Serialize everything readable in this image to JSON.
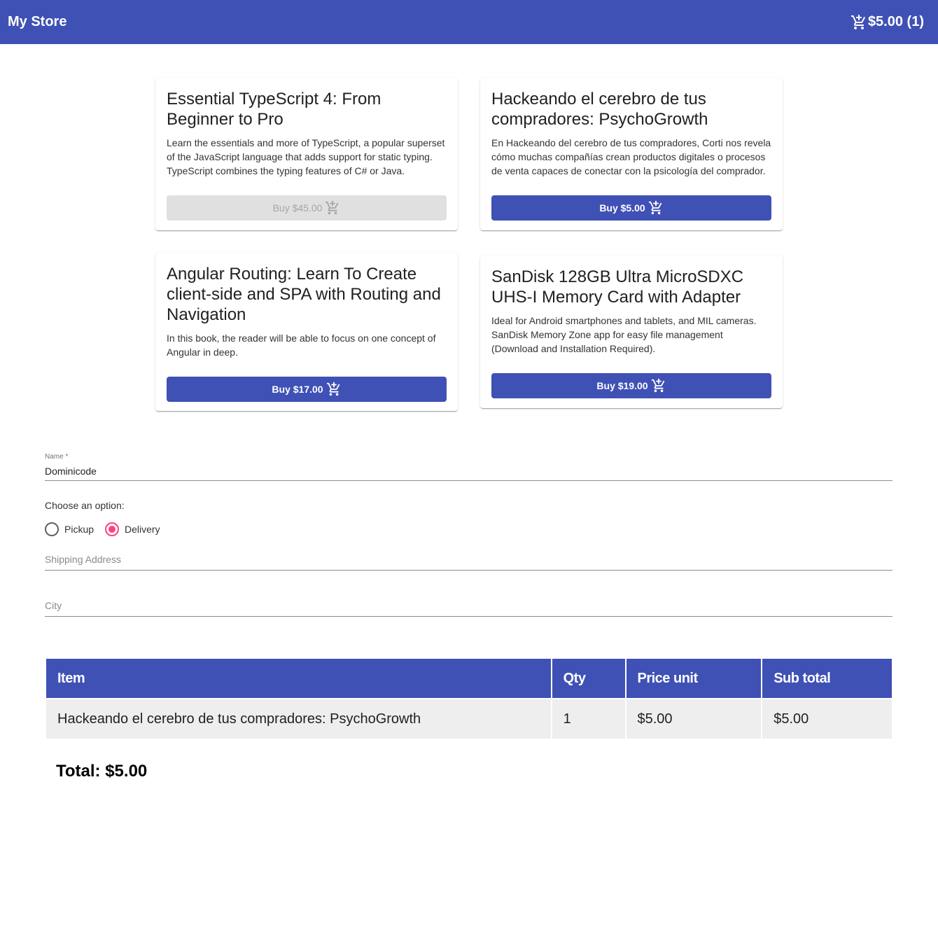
{
  "app": {
    "title": "My Store",
    "cart_total": "$5.00 (1)",
    "colors": {
      "primary": "#3f51b5",
      "accent": "#ff4081",
      "disabled": "#e0e0e0"
    }
  },
  "products": [
    {
      "title": "Essential TypeScript 4: From Beginner to Pro",
      "description": "Learn the essentials and more of TypeScript, a popular superset of the JavaScript language that adds support for static typing. TypeScript combines the typing features of C# or Java.",
      "button_label": "Buy $45.00",
      "button_icon": "add-shopping-cart-icon",
      "disabled": true
    },
    {
      "title": "Hackeando el cerebro de tus compradores: PsychoGrowth",
      "description": "En Hackeando del cerebro de tus compradores, Corti nos revela cómo muchas compañías crean productos digitales o procesos de venta capaces de conectar con la psicología del comprador.",
      "button_label": "Buy $5.00",
      "button_icon": "add-shopping-cart-icon",
      "disabled": false
    },
    {
      "title": "Angular Routing: Learn To Create client-side and SPA with Routing and Navigation",
      "description": "In this book, the reader will be able to focus on one concept of Angular in deep.",
      "button_label": "Buy $17.00",
      "button_icon": "add-shopping-cart-icon",
      "disabled": false
    },
    {
      "title": "SanDisk 128GB Ultra MicroSDXC UHS-I Memory Card with Adapter",
      "description": "Ideal for Android smartphones and tablets, and MIL cameras. SanDisk Memory Zone app for easy file management (Download and Installation Required).",
      "button_label": "Buy $19.00",
      "button_icon": "add-shopping-cart-icon",
      "disabled": false
    }
  ],
  "form": {
    "name_label": "Name *",
    "name_value": "Dominicode",
    "choose_label": "Choose an option:",
    "options": [
      "Pickup",
      "Delivery"
    ],
    "selected_option": "Delivery",
    "shipping_placeholder": "Shipping Address",
    "city_placeholder": "City"
  },
  "cart_table": {
    "headers": [
      "Item",
      "Qty",
      "Price unit",
      "Sub total"
    ],
    "rows": [
      [
        "Hackeando el cerebro de tus compradores: PsychoGrowth",
        "1",
        "$5.00",
        "$5.00"
      ]
    ],
    "total": "Total: $5.00"
  }
}
